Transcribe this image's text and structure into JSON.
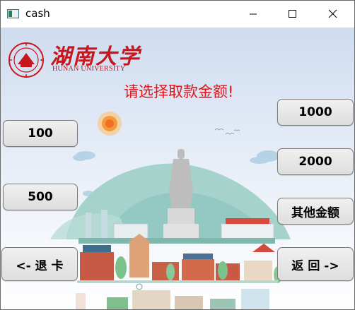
{
  "window": {
    "title": "cash",
    "controls": {
      "minimize": "minimize",
      "maximize": "maximize",
      "close": "close"
    }
  },
  "header": {
    "university_cn": "湖南大学",
    "university_en": "HUNAN UNIVERSITY"
  },
  "prompt": "请选择取款金额!",
  "amount_buttons_left": [
    "100",
    "500"
  ],
  "amount_buttons_right": [
    "1000",
    "2000",
    "其他金额"
  ],
  "nav": {
    "eject_card": "<- 退 卡",
    "back": "返 回 ->"
  },
  "colors": {
    "brand_red": "#c8161d",
    "prompt_red": "#e0141a",
    "button_face": "#e3e3e3",
    "sky_top": "#cfdcf0"
  },
  "icons": [
    "app-icon",
    "minimize-icon",
    "maximize-icon",
    "close-icon",
    "university-seal-icon"
  ]
}
